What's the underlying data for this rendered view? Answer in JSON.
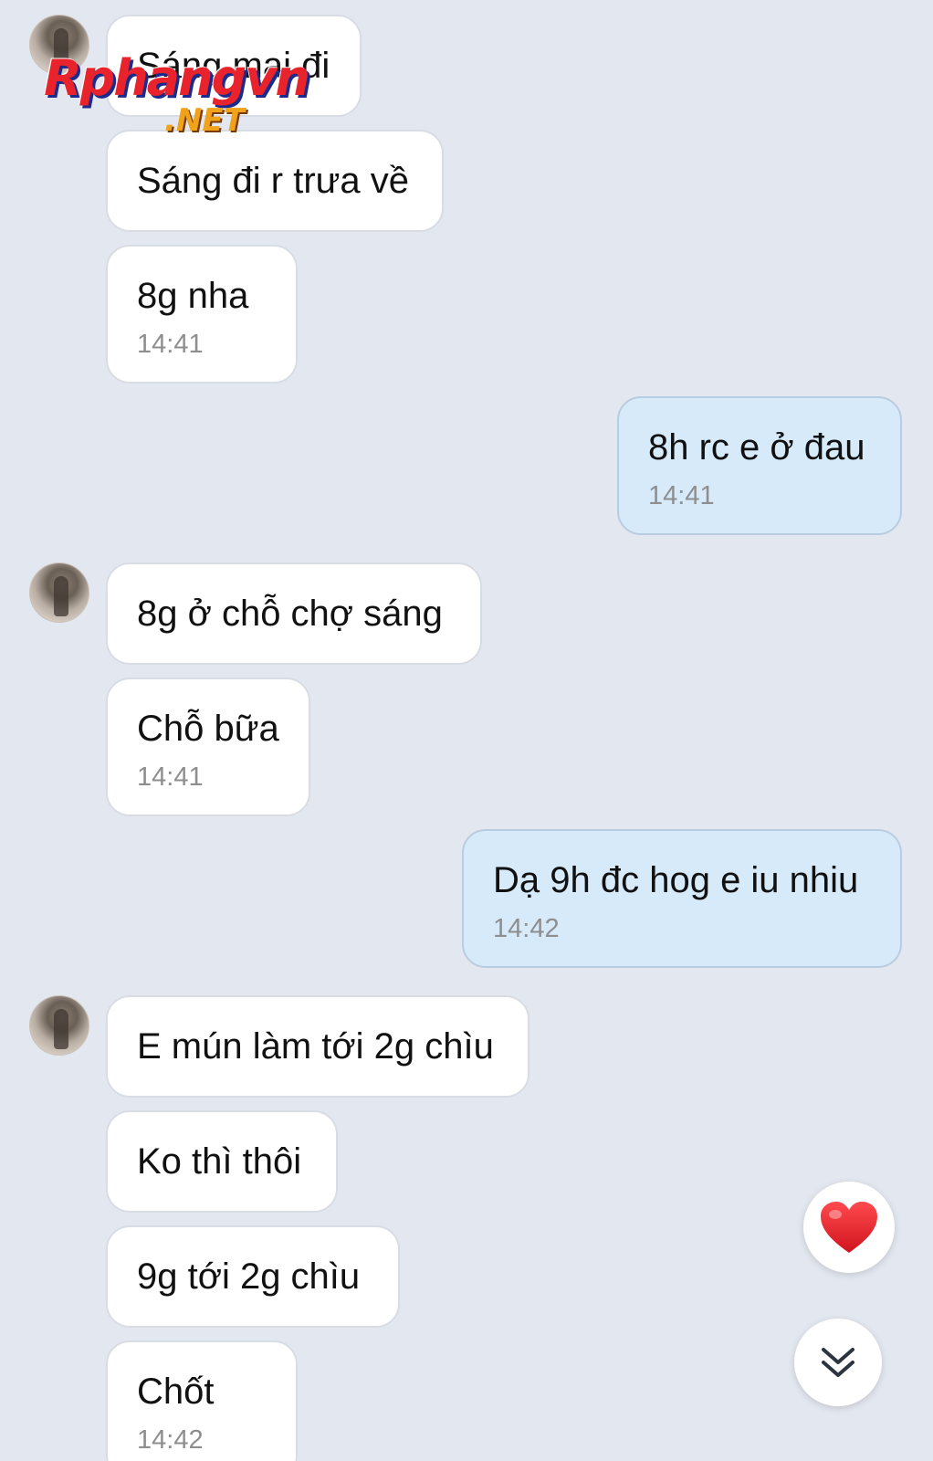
{
  "watermark": {
    "main": "Rphangvn",
    "sub": ".NET"
  },
  "messages": [
    {
      "text": "Sáng mai đi"
    },
    {
      "text": "Sáng đi r trưa về"
    },
    {
      "text": "8g nha",
      "time": "14:41"
    },
    {
      "text": "8h rc e ở đau",
      "time": "14:41"
    },
    {
      "text": "8g ở chỗ chợ sáng"
    },
    {
      "text": "Chỗ bữa",
      "time": "14:41"
    },
    {
      "text": "Dạ 9h đc hog e iu nhiu",
      "time": "14:42"
    },
    {
      "text": "E mún làm tới 2g chìu"
    },
    {
      "text": "Ko thì thôi"
    },
    {
      "text": "9g tới 2g chìu"
    },
    {
      "text": "Chốt",
      "time": "14:42"
    }
  ],
  "colors": {
    "background": "#e3e7ef",
    "incoming_bubble": "#ffffff",
    "outgoing_bubble": "#d7eafa",
    "heart": "#e0202a"
  },
  "icons": {
    "reaction": "heart-icon",
    "scroll": "double-chevron-down-icon"
  }
}
